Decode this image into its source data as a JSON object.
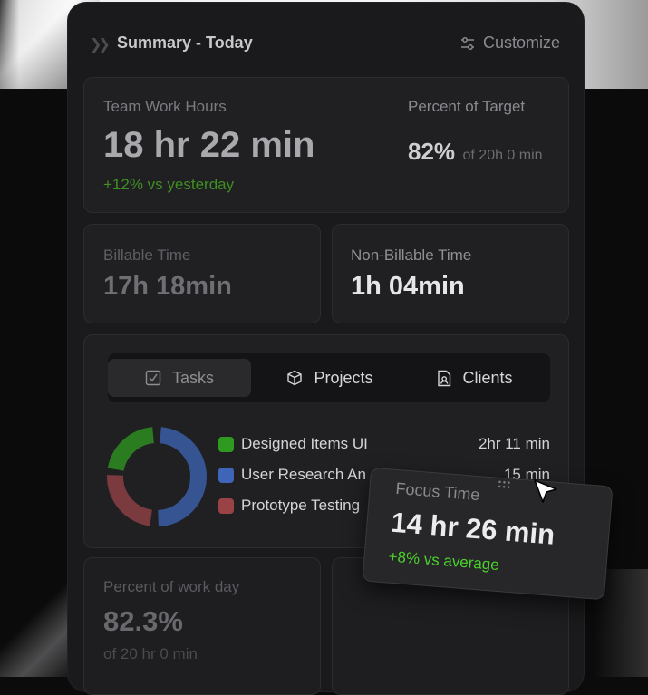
{
  "header": {
    "collapse_icon": "chevrons-right-icon",
    "title": "Summary - Today",
    "customize_label": "Customize",
    "customize_icon": "sliders-icon"
  },
  "work_hours": {
    "label": "Team Work Hours",
    "value": "18 hr 22 min",
    "change": "+12% vs yesterday",
    "target_label": "Percent of Target",
    "target_percent": "82%",
    "target_of": "of 20h 0 min"
  },
  "billable": {
    "label": "Billable Time",
    "value": "17h 18min"
  },
  "non_billable": {
    "label": "Non-Billable Time",
    "value": "1h 04min"
  },
  "tabs": [
    {
      "label": "Tasks",
      "icon": "checkbox-icon",
      "active": true
    },
    {
      "label": "Projects",
      "icon": "cube-icon",
      "active": false
    },
    {
      "label": "Clients",
      "icon": "contact-file-icon",
      "active": false
    }
  ],
  "breakdown": {
    "items": [
      {
        "label": "Designed Items UI",
        "value": "2hr 11 min",
        "color": "#2f9a20"
      },
      {
        "label": "User Research An",
        "value": "15 min",
        "color": "#3e65b8"
      },
      {
        "label": "Prototype Testing",
        "value": "",
        "color": "#9a4347"
      }
    ]
  },
  "work_day": {
    "label": "Percent of work day",
    "value": "82.3%",
    "of": "of 20 hr 0 min"
  },
  "focus": {
    "label": "Focus Time",
    "value": "14 hr 26 min",
    "change": "+8% vs average",
    "drag_icon": "drag-handle-icon",
    "cursor_icon": "cursor-arrow-icon"
  },
  "colors": {
    "positive": "#4bd12a",
    "panel": "#1a1a1c",
    "card": "#202023"
  }
}
